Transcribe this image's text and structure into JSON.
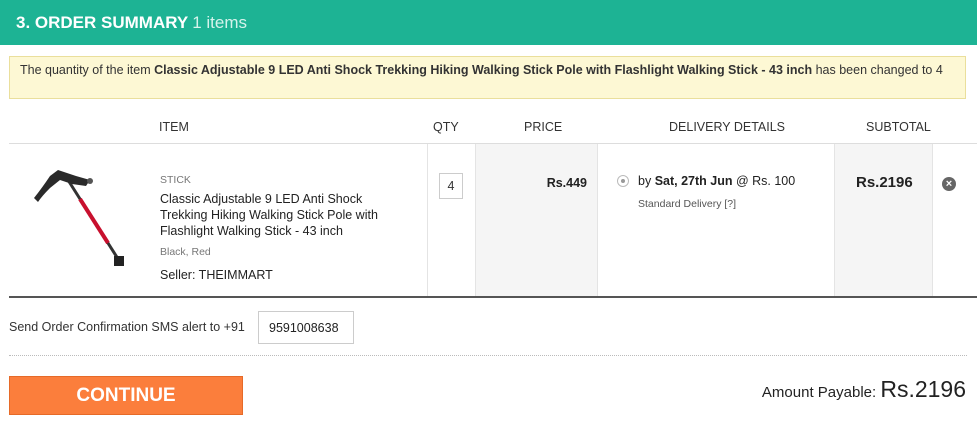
{
  "header": {
    "title": "3. ORDER SUMMARY",
    "count": "1 items"
  },
  "notice": {
    "prefix": "The quantity of the item ",
    "item": "Classic Adjustable 9 LED Anti Shock Trekking Hiking Walking Stick Pole with Flashlight Walking Stick - 43 inch",
    "suffix": " has been changed to 4"
  },
  "table": {
    "headers": {
      "item": "ITEM",
      "qty": "QTY",
      "price": "PRICE",
      "delivery": "DELIVERY DETAILS",
      "subtotal": "SUBTOTAL"
    },
    "row": {
      "category": "STICK",
      "name": "Classic Adjustable 9 LED Anti Shock Trekking Hiking Walking Stick Pole with Flashlight Walking Stick - 43 inch",
      "color": "Black, Red",
      "seller": "Seller: THEIMMART",
      "qty": "4",
      "price": "Rs.449",
      "delivery_by": "by ",
      "delivery_date": "Sat, 27th Jun",
      "delivery_charge": " @ Rs. 100",
      "delivery_type": "Standard Delivery [?]",
      "subtotal": "Rs.2196",
      "remove_icon": "close-icon"
    }
  },
  "sms": {
    "label": "Send Order Confirmation SMS alert to +91",
    "phone": "9591008638"
  },
  "footer": {
    "continue_label": "CONTINUE",
    "amount_label": "Amount Payable: ",
    "amount_value": "Rs.2196"
  },
  "colors": {
    "header_bg": "#1db394",
    "continue_bg": "#fb7e3c",
    "notice_bg": "#fdf8d4"
  }
}
